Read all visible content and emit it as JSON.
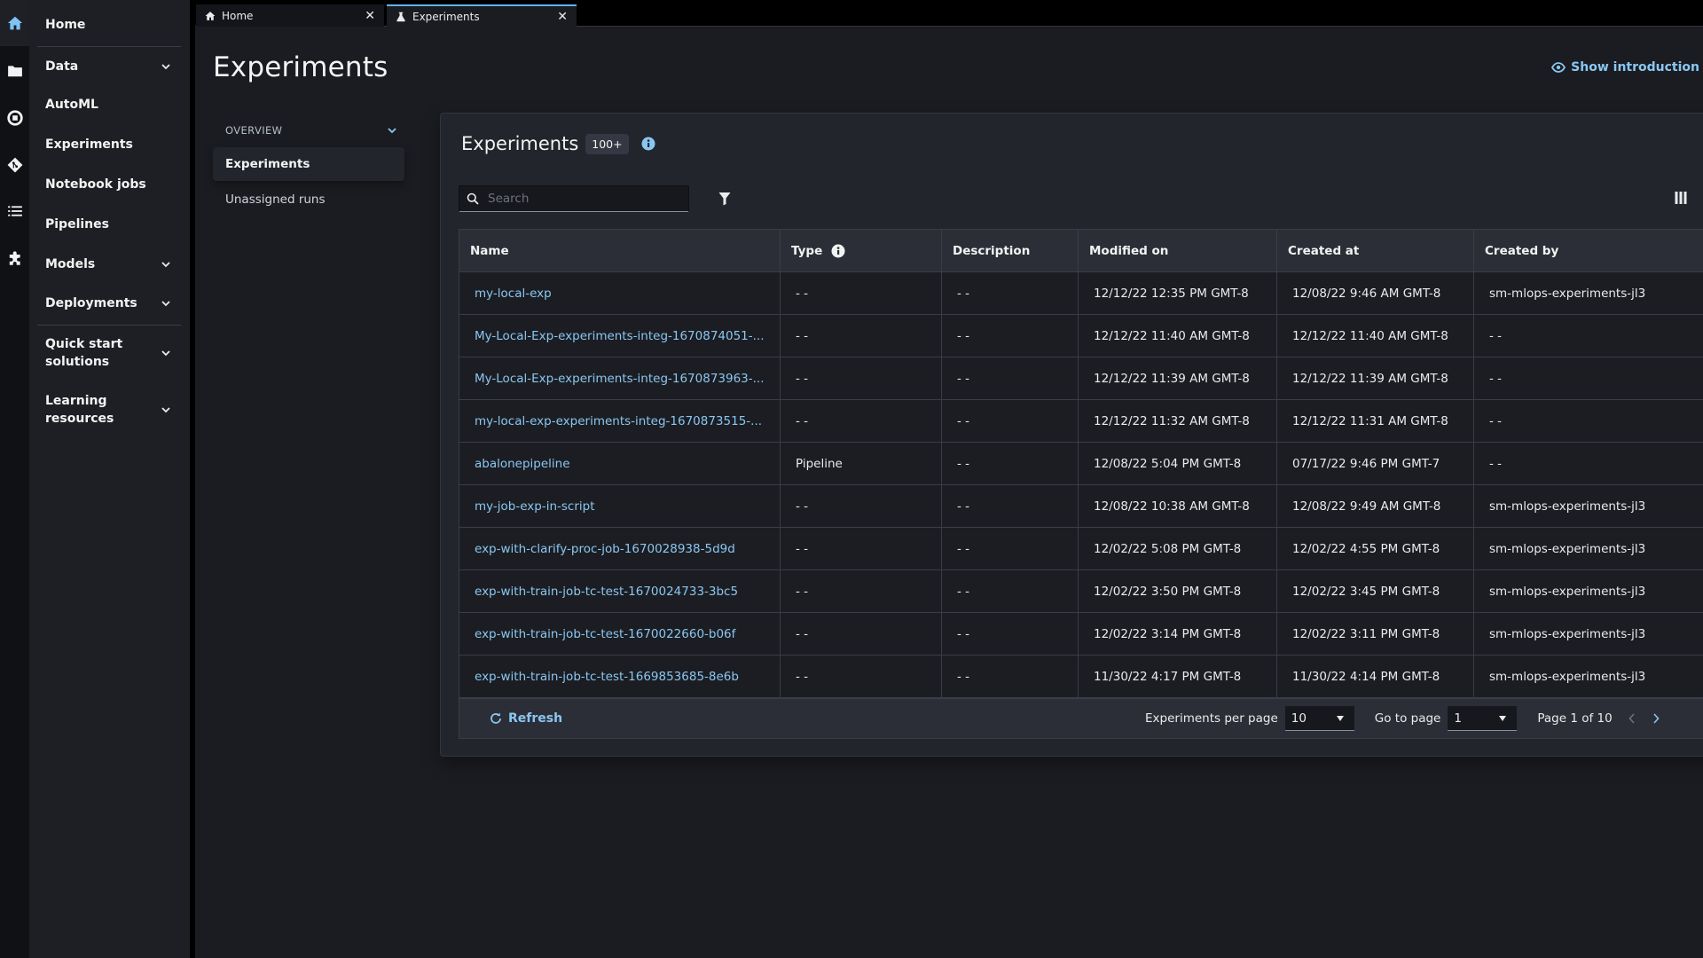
{
  "rail": {
    "icons": [
      "home-icon",
      "folder-icon",
      "stop-circle-icon",
      "git-icon",
      "list-icon",
      "puzzle-icon"
    ]
  },
  "nav": {
    "items": [
      {
        "label": "Home",
        "expandable": false
      },
      {
        "label": "Data",
        "expandable": true
      },
      {
        "label": "AutoML",
        "expandable": false
      },
      {
        "label": "Experiments",
        "expandable": false
      },
      {
        "label": "Notebook jobs",
        "expandable": false
      },
      {
        "label": "Pipelines",
        "expandable": false
      },
      {
        "label": "Models",
        "expandable": true
      },
      {
        "label": "Deployments",
        "expandable": true
      },
      {
        "label": "Quick start solutions",
        "expandable": true
      },
      {
        "label": "Learning resources",
        "expandable": true
      }
    ]
  },
  "tabs": [
    {
      "label": "Home",
      "icon": "home-icon",
      "active": false
    },
    {
      "label": "Experiments",
      "icon": "flask-icon",
      "active": true
    }
  ],
  "page": {
    "title": "Experiments",
    "show_intro_label": "Show introduction"
  },
  "subnav": {
    "section_label": "OVERVIEW",
    "items": [
      {
        "label": "Experiments",
        "active": true
      },
      {
        "label": "Unassigned runs",
        "active": false
      }
    ]
  },
  "experiments": {
    "title": "Experiments",
    "count_badge": "100+",
    "search_placeholder": "Search",
    "search_value": "",
    "columns": [
      "Name",
      "Type",
      "Description",
      "Modified on",
      "Created at",
      "Created by"
    ],
    "rows": [
      {
        "name": "my-local-exp",
        "type": "- -",
        "description": "- -",
        "modified_on": "12/12/22 12:35 PM GMT-8",
        "created_at": "12/08/22 9:46 AM GMT-8",
        "created_by": "sm-mlops-experiments-jl3"
      },
      {
        "name": "My-Local-Exp-experiments-integ-1670874051-...",
        "type": "- -",
        "description": "- -",
        "modified_on": "12/12/22 11:40 AM GMT-8",
        "created_at": "12/12/22 11:40 AM GMT-8",
        "created_by": "- -"
      },
      {
        "name": "My-Local-Exp-experiments-integ-1670873963-...",
        "type": "- -",
        "description": "- -",
        "modified_on": "12/12/22 11:39 AM GMT-8",
        "created_at": "12/12/22 11:39 AM GMT-8",
        "created_by": "- -"
      },
      {
        "name": "my-local-exp-experiments-integ-1670873515-...",
        "type": "- -",
        "description": "- -",
        "modified_on": "12/12/22 11:32 AM GMT-8",
        "created_at": "12/12/22 11:31 AM GMT-8",
        "created_by": "- -"
      },
      {
        "name": "abalonepipeline",
        "type": "Pipeline",
        "description": "- -",
        "modified_on": "12/08/22 5:04 PM GMT-8",
        "created_at": "07/17/22 9:46 PM GMT-7",
        "created_by": "- -"
      },
      {
        "name": "my-job-exp-in-script",
        "type": "- -",
        "description": "- -",
        "modified_on": "12/08/22 10:38 AM GMT-8",
        "created_at": "12/08/22 9:49 AM GMT-8",
        "created_by": "sm-mlops-experiments-jl3"
      },
      {
        "name": "exp-with-clarify-proc-job-1670028938-5d9d",
        "type": "- -",
        "description": "- -",
        "modified_on": "12/02/22 5:08 PM GMT-8",
        "created_at": "12/02/22 4:55 PM GMT-8",
        "created_by": "sm-mlops-experiments-jl3"
      },
      {
        "name": "exp-with-train-job-tc-test-1670024733-3bc5",
        "type": "- -",
        "description": "- -",
        "modified_on": "12/02/22 3:50 PM GMT-8",
        "created_at": "12/02/22 3:45 PM GMT-8",
        "created_by": "sm-mlops-experiments-jl3"
      },
      {
        "name": "exp-with-train-job-tc-test-1670022660-b06f",
        "type": "- -",
        "description": "- -",
        "modified_on": "12/02/22 3:14 PM GMT-8",
        "created_at": "12/02/22 3:11 PM GMT-8",
        "created_by": "sm-mlops-experiments-jl3"
      },
      {
        "name": "exp-with-train-job-tc-test-1669853685-8e6b",
        "type": "- -",
        "description": "- -",
        "modified_on": "11/30/22 4:17 PM GMT-8",
        "created_at": "11/30/22 4:14 PM GMT-8",
        "created_by": "sm-mlops-experiments-jl3"
      }
    ],
    "footer": {
      "refresh_label": "Refresh",
      "per_page_label": "Experiments per page",
      "per_page_value": "10",
      "go_to_page_label": "Go to page",
      "go_to_page_value": "1",
      "page_info": "Page 1 of 10"
    }
  },
  "colors": {
    "accent": "#89c7f2",
    "tab_active_border": "#5fb3e8",
    "background": "#1b1c21",
    "panel": "#23252d"
  }
}
